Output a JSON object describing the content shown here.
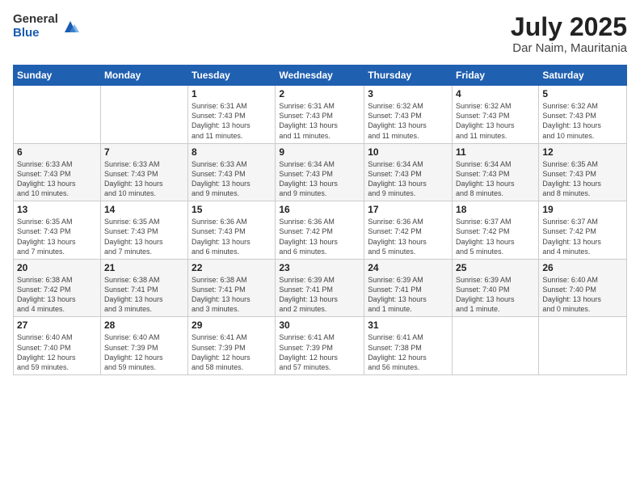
{
  "logo": {
    "general": "General",
    "blue": "Blue"
  },
  "title": "July 2025",
  "location": "Dar Naim, Mauritania",
  "headers": [
    "Sunday",
    "Monday",
    "Tuesday",
    "Wednesday",
    "Thursday",
    "Friday",
    "Saturday"
  ],
  "weeks": [
    [
      {
        "day": "",
        "info": ""
      },
      {
        "day": "",
        "info": ""
      },
      {
        "day": "1",
        "info": "Sunrise: 6:31 AM\nSunset: 7:43 PM\nDaylight: 13 hours\nand 11 minutes."
      },
      {
        "day": "2",
        "info": "Sunrise: 6:31 AM\nSunset: 7:43 PM\nDaylight: 13 hours\nand 11 minutes."
      },
      {
        "day": "3",
        "info": "Sunrise: 6:32 AM\nSunset: 7:43 PM\nDaylight: 13 hours\nand 11 minutes."
      },
      {
        "day": "4",
        "info": "Sunrise: 6:32 AM\nSunset: 7:43 PM\nDaylight: 13 hours\nand 11 minutes."
      },
      {
        "day": "5",
        "info": "Sunrise: 6:32 AM\nSunset: 7:43 PM\nDaylight: 13 hours\nand 10 minutes."
      }
    ],
    [
      {
        "day": "6",
        "info": "Sunrise: 6:33 AM\nSunset: 7:43 PM\nDaylight: 13 hours\nand 10 minutes."
      },
      {
        "day": "7",
        "info": "Sunrise: 6:33 AM\nSunset: 7:43 PM\nDaylight: 13 hours\nand 10 minutes."
      },
      {
        "day": "8",
        "info": "Sunrise: 6:33 AM\nSunset: 7:43 PM\nDaylight: 13 hours\nand 9 minutes."
      },
      {
        "day": "9",
        "info": "Sunrise: 6:34 AM\nSunset: 7:43 PM\nDaylight: 13 hours\nand 9 minutes."
      },
      {
        "day": "10",
        "info": "Sunrise: 6:34 AM\nSunset: 7:43 PM\nDaylight: 13 hours\nand 9 minutes."
      },
      {
        "day": "11",
        "info": "Sunrise: 6:34 AM\nSunset: 7:43 PM\nDaylight: 13 hours\nand 8 minutes."
      },
      {
        "day": "12",
        "info": "Sunrise: 6:35 AM\nSunset: 7:43 PM\nDaylight: 13 hours\nand 8 minutes."
      }
    ],
    [
      {
        "day": "13",
        "info": "Sunrise: 6:35 AM\nSunset: 7:43 PM\nDaylight: 13 hours\nand 7 minutes."
      },
      {
        "day": "14",
        "info": "Sunrise: 6:35 AM\nSunset: 7:43 PM\nDaylight: 13 hours\nand 7 minutes."
      },
      {
        "day": "15",
        "info": "Sunrise: 6:36 AM\nSunset: 7:43 PM\nDaylight: 13 hours\nand 6 minutes."
      },
      {
        "day": "16",
        "info": "Sunrise: 6:36 AM\nSunset: 7:42 PM\nDaylight: 13 hours\nand 6 minutes."
      },
      {
        "day": "17",
        "info": "Sunrise: 6:36 AM\nSunset: 7:42 PM\nDaylight: 13 hours\nand 5 minutes."
      },
      {
        "day": "18",
        "info": "Sunrise: 6:37 AM\nSunset: 7:42 PM\nDaylight: 13 hours\nand 5 minutes."
      },
      {
        "day": "19",
        "info": "Sunrise: 6:37 AM\nSunset: 7:42 PM\nDaylight: 13 hours\nand 4 minutes."
      }
    ],
    [
      {
        "day": "20",
        "info": "Sunrise: 6:38 AM\nSunset: 7:42 PM\nDaylight: 13 hours\nand 4 minutes."
      },
      {
        "day": "21",
        "info": "Sunrise: 6:38 AM\nSunset: 7:41 PM\nDaylight: 13 hours\nand 3 minutes."
      },
      {
        "day": "22",
        "info": "Sunrise: 6:38 AM\nSunset: 7:41 PM\nDaylight: 13 hours\nand 3 minutes."
      },
      {
        "day": "23",
        "info": "Sunrise: 6:39 AM\nSunset: 7:41 PM\nDaylight: 13 hours\nand 2 minutes."
      },
      {
        "day": "24",
        "info": "Sunrise: 6:39 AM\nSunset: 7:41 PM\nDaylight: 13 hours\nand 1 minute."
      },
      {
        "day": "25",
        "info": "Sunrise: 6:39 AM\nSunset: 7:40 PM\nDaylight: 13 hours\nand 1 minute."
      },
      {
        "day": "26",
        "info": "Sunrise: 6:40 AM\nSunset: 7:40 PM\nDaylight: 13 hours\nand 0 minutes."
      }
    ],
    [
      {
        "day": "27",
        "info": "Sunrise: 6:40 AM\nSunset: 7:40 PM\nDaylight: 12 hours\nand 59 minutes."
      },
      {
        "day": "28",
        "info": "Sunrise: 6:40 AM\nSunset: 7:39 PM\nDaylight: 12 hours\nand 59 minutes."
      },
      {
        "day": "29",
        "info": "Sunrise: 6:41 AM\nSunset: 7:39 PM\nDaylight: 12 hours\nand 58 minutes."
      },
      {
        "day": "30",
        "info": "Sunrise: 6:41 AM\nSunset: 7:39 PM\nDaylight: 12 hours\nand 57 minutes."
      },
      {
        "day": "31",
        "info": "Sunrise: 6:41 AM\nSunset: 7:38 PM\nDaylight: 12 hours\nand 56 minutes."
      },
      {
        "day": "",
        "info": ""
      },
      {
        "day": "",
        "info": ""
      }
    ]
  ]
}
